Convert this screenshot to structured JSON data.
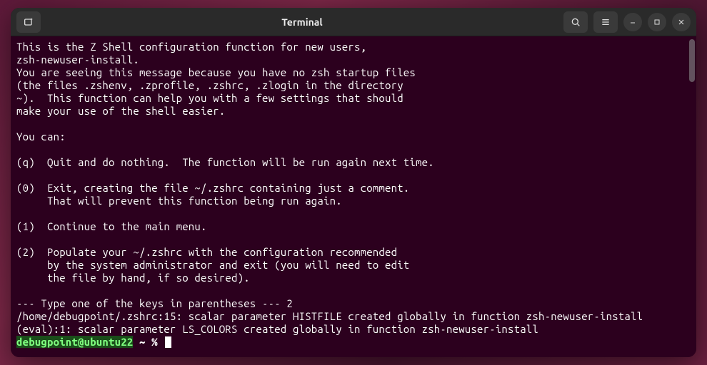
{
  "titlebar": {
    "title": "Terminal"
  },
  "terminal": {
    "lines": [
      "This is the Z Shell configuration function for new users,",
      "zsh-newuser-install.",
      "You are seeing this message because you have no zsh startup files",
      "(the files .zshenv, .zprofile, .zshrc, .zlogin in the directory",
      "~).  This function can help you with a few settings that should",
      "make your use of the shell easier.",
      "",
      "You can:",
      "",
      "(q)  Quit and do nothing.  The function will be run again next time.",
      "",
      "(0)  Exit, creating the file ~/.zshrc containing just a comment.",
      "     That will prevent this function being run again.",
      "",
      "(1)  Continue to the main menu.",
      "",
      "(2)  Populate your ~/.zshrc with the configuration recommended",
      "     by the system administrator and exit (you will need to edit",
      "     the file by hand, if so desired).",
      "",
      "--- Type one of the keys in parentheses --- 2",
      "/home/debugpoint/.zshrc:15: scalar parameter HISTFILE created globally in function zsh-newuser-install",
      "(eval):1: scalar parameter LS_COLORS created globally in function zsh-newuser-install"
    ],
    "prompt": {
      "user_host": "debugpoint@ubuntu22",
      "path": " ~ ",
      "symbol": "% "
    }
  }
}
